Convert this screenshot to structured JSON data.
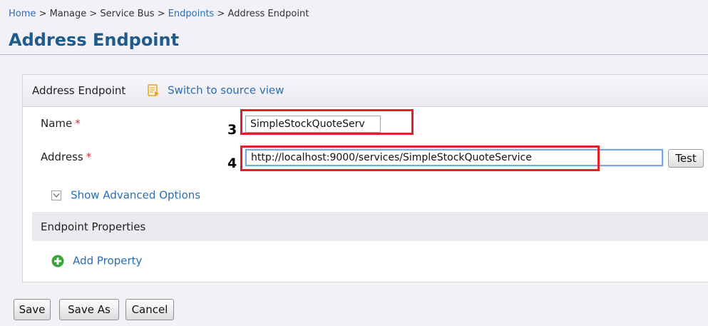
{
  "breadcrumb": {
    "items": [
      {
        "label": "Home"
      },
      {
        "label": "Manage"
      },
      {
        "label": "Service Bus"
      },
      {
        "label": "Endpoints"
      },
      {
        "label": "Address Endpoint"
      }
    ],
    "separator": ">"
  },
  "page": {
    "title": "Address Endpoint"
  },
  "panel": {
    "header_title": "Address Endpoint",
    "source_link_label": "Switch to source view",
    "source_icon": "source-view-icon"
  },
  "form": {
    "name_label": "Name",
    "name_value": "SimpleStockQuoteServ",
    "address_label": "Address",
    "address_value": "http://localhost:9000/services/SimpleStockQuoteService",
    "required_marker": "*",
    "test_button_label": "Test",
    "advanced_options_label": "Show Advanced Options"
  },
  "annotations": {
    "name_step": "3",
    "address_step": "4",
    "highlight_color": "#e0212a"
  },
  "properties": {
    "section_label": "Endpoint Properties",
    "add_property_label": "Add Property",
    "add_icon": "plus-circle-icon"
  },
  "footer": {
    "save_label": "Save",
    "save_as_label": "Save As",
    "cancel_label": "Cancel"
  },
  "colors": {
    "link": "#2a6db5",
    "title": "#1f5b8c",
    "required": "#dd3333",
    "add_icon_green": "#3aa53a"
  }
}
